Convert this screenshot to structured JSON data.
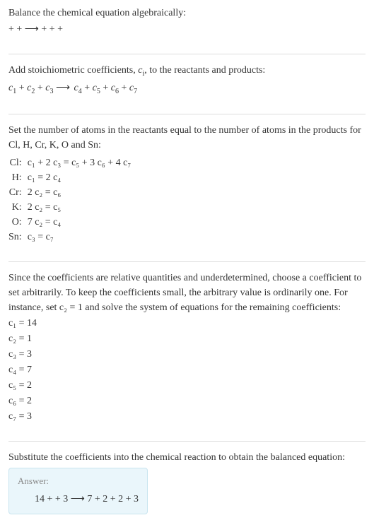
{
  "section1": {
    "title": "Balance the chemical equation algebraically:",
    "eq": " +  +  ⟶  +  +  + "
  },
  "section2": {
    "title": "Add stoichiometric coefficients, cᵢ, to the reactants and products:",
    "title_pre": "Add stoichiometric coefficients, ",
    "title_ci": "c",
    "title_i": "i",
    "title_post": ", to the reactants and products:",
    "eq_c1": "c",
    "eq_1": "1",
    "eq_plus": " + ",
    "eq_c2": "c",
    "eq_2": "2",
    "eq_c3": "c",
    "eq_3": "3",
    "eq_arrow": " ⟶ ",
    "eq_c4": "c",
    "eq_4": "4",
    "eq_c5": "c",
    "eq_5": "5",
    "eq_c6": "c",
    "eq_6": "6",
    "eq_c7": "c",
    "eq_7": "7"
  },
  "section3": {
    "title": "Set the number of atoms in the reactants equal to the number of atoms in the products for Cl, H, Cr, K, O and Sn:",
    "rows": [
      {
        "label": "Cl:",
        "eq": "c₁ + 2 c₃ = c₅ + 3 c₆ + 4 c₇"
      },
      {
        "label": "H:",
        "eq": "c₁ = 2 c₄"
      },
      {
        "label": "Cr:",
        "eq": "2 c₂ = c₆"
      },
      {
        "label": "K:",
        "eq": "2 c₂ = c₅"
      },
      {
        "label": "O:",
        "eq": "7 c₂ = c₄"
      },
      {
        "label": "Sn:",
        "eq": "c₃ = c₇"
      }
    ]
  },
  "section4": {
    "title": "Since the coefficients are relative quantities and underdetermined, choose a coefficient to set arbitrarily. To keep the coefficients small, the arbitrary value is ordinarily one. For instance, set c₂ = 1 and solve the system of equations for the remaining coefficients:",
    "coefs": [
      "c₁ = 14",
      "c₂ = 1",
      "c₃ = 3",
      "c₄ = 7",
      "c₅ = 2",
      "c₆ = 2",
      "c₇ = 3"
    ]
  },
  "section5": {
    "title": "Substitute the coefficients into the chemical reaction to obtain the balanced equation:",
    "answer_label": "Answer:",
    "answer_eq": "14  +  + 3  ⟶ 7  + 2  + 2  + 3 "
  }
}
